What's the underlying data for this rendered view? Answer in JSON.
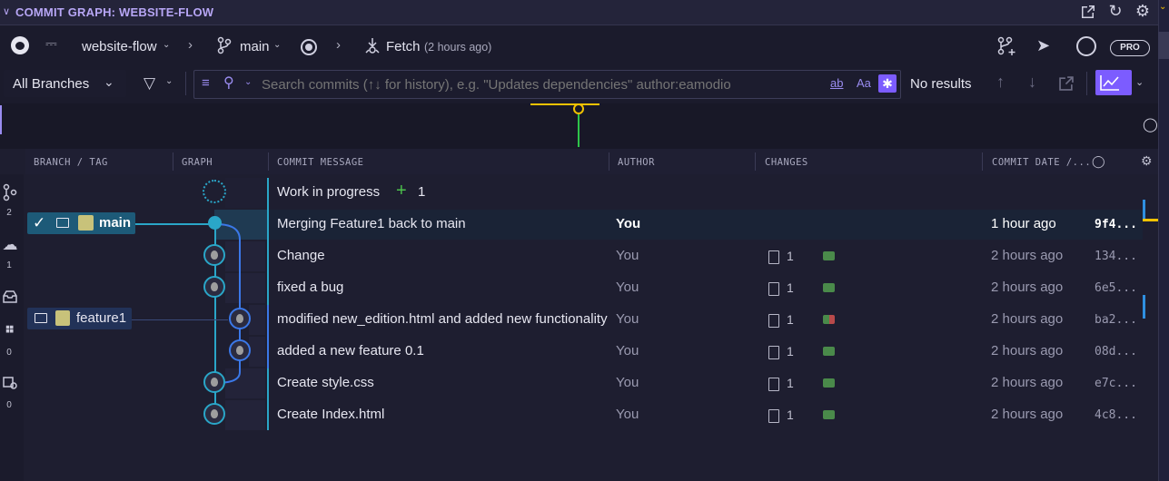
{
  "header": {
    "title": "COMMIT GRAPH: WEBSITE-FLOW",
    "icons": [
      "open-in-editor-icon",
      "refresh-icon",
      "gear-icon"
    ]
  },
  "toolbar": {
    "repo": "website-flow",
    "branch": "main",
    "fetch_label": "Fetch",
    "fetch_time": "(2 hours ago)",
    "pro_badge": "PRO"
  },
  "search": {
    "branches_select": "All Branches",
    "placeholder": "Search commits (↑↓ for history), e.g. \"Updates dependencies\" author:eamodio",
    "results": "No results",
    "toggle_regex": "ab",
    "toggle_case": "Aa"
  },
  "columns": {
    "branch_tag": "BRANCH / TAG",
    "graph": "GRAPH",
    "commit_message": "COMMIT MESSAGE",
    "author": "AUTHOR",
    "changes": "CHANGES",
    "commit_date": "COMMIT DATE /..."
  },
  "sidebar": {
    "counts": [
      "2",
      "1",
      "0",
      "0"
    ]
  },
  "refs": {
    "main": "main",
    "feature1": "feature1"
  },
  "wip": {
    "label": "Work in progress",
    "plus": "+",
    "count": "1"
  },
  "commits": [
    {
      "message": "Merging Feature1 back to main",
      "author": "You",
      "changes": "",
      "date": "1 hour ago",
      "sha": "9f4..."
    },
    {
      "message": "Change",
      "author": "You",
      "changes": "1",
      "date": "2 hours ago",
      "sha": "134..."
    },
    {
      "message": "fixed a bug",
      "author": "You",
      "changes": "1",
      "date": "2 hours ago",
      "sha": "6e5..."
    },
    {
      "message": "modified new_edition.html and added new functionality",
      "author": "You",
      "changes": "1",
      "date": "2 hours ago",
      "sha": "ba2..."
    },
    {
      "message": "added a new feature 0.1",
      "author": "You",
      "changes": "1",
      "date": "2 hours ago",
      "sha": "08d..."
    },
    {
      "message": "Create style.css",
      "author": "You",
      "changes": "1",
      "date": "2 hours ago",
      "sha": "e7c..."
    },
    {
      "message": "Create Index.html",
      "author": "You",
      "changes": "1",
      "date": "2 hours ago",
      "sha": "4c8..."
    }
  ],
  "colors": {
    "accent": "#7c5cff",
    "main_lane": "#2aa6c8",
    "feature_lane": "#3b78e8",
    "added": "#4a8a4a",
    "modified": "#b84a4a"
  }
}
